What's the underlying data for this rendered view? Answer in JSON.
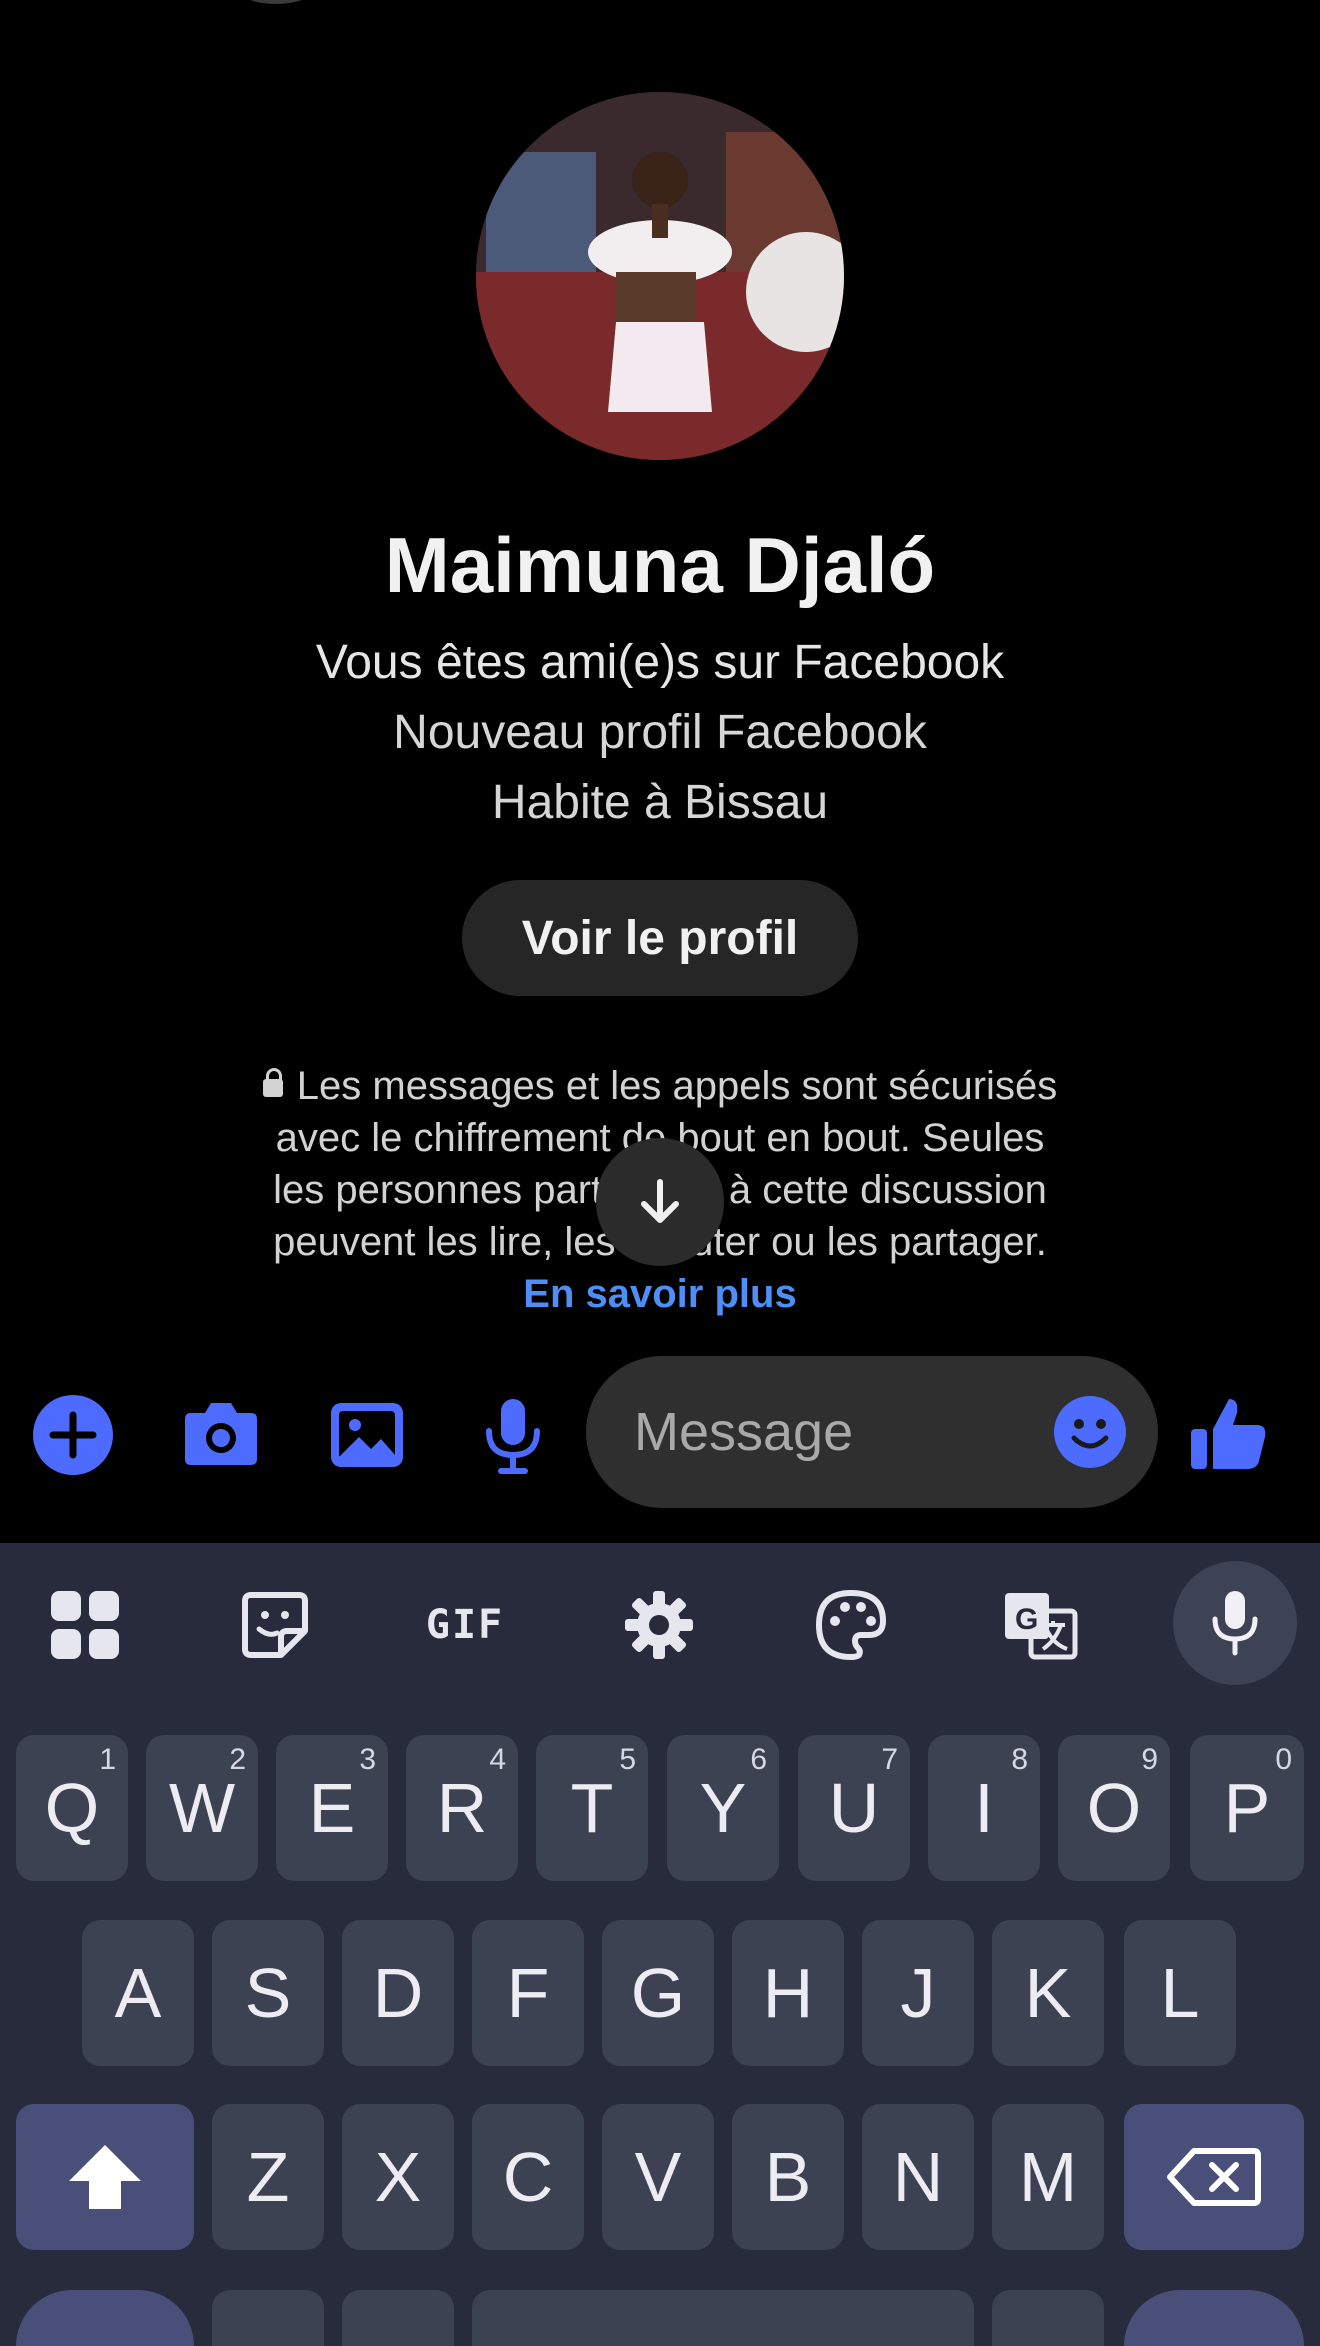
{
  "contact": {
    "name": "Maimuna Djaló",
    "friend_status": "Vous êtes ami(e)s sur Facebook",
    "profile_note": "Nouveau profil Facebook",
    "location": "Habite à Bissau",
    "view_profile_label": "Voir le profil"
  },
  "encryption_notice": {
    "lines": [
      "Les messages et les appels sont sécurisés",
      "avec le chiffrement de bout en bout. Seules",
      "les personnes participant à cette discussion",
      "peuvent les lire, les écouter ou les partager."
    ],
    "link_label": "En savoir plus"
  },
  "composer": {
    "placeholder": "Message",
    "icons": [
      "plus-icon",
      "camera-icon",
      "gallery-icon",
      "microphone-icon",
      "emoji-icon",
      "thumbs-up-icon"
    ]
  },
  "keyboard": {
    "toolbar": {
      "gif_label": "GIF",
      "icons": [
        "apps-grid-icon",
        "sticker-icon",
        "settings-icon",
        "palette-icon",
        "translate-icon",
        "microphone-icon"
      ]
    },
    "row1": [
      {
        "label": "Q",
        "hint": "1"
      },
      {
        "label": "W",
        "hint": "2"
      },
      {
        "label": "E",
        "hint": "3"
      },
      {
        "label": "R",
        "hint": "4"
      },
      {
        "label": "T",
        "hint": "5"
      },
      {
        "label": "Y",
        "hint": "6"
      },
      {
        "label": "U",
        "hint": "7"
      },
      {
        "label": "I",
        "hint": "8"
      },
      {
        "label": "O",
        "hint": "9"
      },
      {
        "label": "P",
        "hint": "0"
      }
    ],
    "row2": [
      "A",
      "S",
      "D",
      "F",
      "G",
      "H",
      "J",
      "K",
      "L"
    ],
    "row3": [
      "Z",
      "X",
      "C",
      "V",
      "B",
      "N",
      "M"
    ]
  },
  "colors": {
    "accent": "#4d6bfe",
    "link": "#4d8ef7",
    "keyboard_bg": "#272b3c",
    "key_bg": "#3d4253",
    "special_key_bg": "#4a4f7a"
  }
}
